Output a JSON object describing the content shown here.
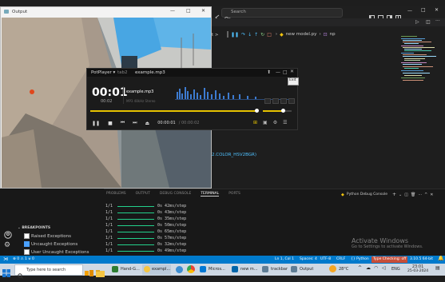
{
  "vscode": {
    "search_placeholder": "Search",
    "breadcrumb_prefix": "t > ",
    "breadcrumb_file": "new model.py",
    "breadcrumb_symbol": "np",
    "code_line": "2.COLOR_HSV2BGR)"
  },
  "output_window": {
    "title": "Output"
  },
  "potplayer": {
    "app_name": "PotPlayer",
    "tab": "tab2",
    "file_title": "example.mp3",
    "time_main": "00:01",
    "time_sub": "00:02",
    "track_name": "example.mp3",
    "info": "MP3   48kHz   Stereo",
    "tooltip": "Exit",
    "current_time": "00:00:01",
    "total_time": "00:00:02"
  },
  "panel": {
    "tabs": [
      "PROBLEMS",
      "OUTPUT",
      "DEBUG CONSOLE",
      "TERMINAL",
      "PORTS"
    ],
    "active_tab": "TERMINAL",
    "debug_console_label": "Python Debug Console",
    "terminal_lines": [
      {
        "step": "1/1",
        "ms": "0s 42ms/step"
      },
      {
        "step": "1/1",
        "ms": "0s 43ms/step"
      },
      {
        "step": "1/1",
        "ms": "0s 35ms/step"
      },
      {
        "step": "1/1",
        "ms": "0s 50ms/step"
      },
      {
        "step": "1/1",
        "ms": "0s 65ms/step"
      },
      {
        "step": "1/1",
        "ms": "0s 57ms/step"
      },
      {
        "step": "1/1",
        "ms": "0s 32ms/step"
      },
      {
        "step": "1/1",
        "ms": "0s 49ms/step"
      }
    ]
  },
  "sidebar": {
    "breakpoints_title": "BREAKPOINTS",
    "items": [
      {
        "label": "Raised Exceptions",
        "checked": false
      },
      {
        "label": "Uncaught Exceptions",
        "checked": true
      },
      {
        "label": "User Uncaught Exceptions",
        "checked": false
      }
    ]
  },
  "watermark": {
    "title": "Activate Windows",
    "subtitle": "Go to Settings to activate Windows."
  },
  "statusbar": {
    "left": "⊗ 0 ⚠ 1   ⊌ 0",
    "position": "Ln 1, Col 1",
    "spaces": "Spaces: 4",
    "encoding": "UTF-8",
    "eol": "CRLF",
    "language": "Python",
    "type_checking": "Type Checking: off",
    "python_version": "3.10.5 64-bit"
  },
  "taskbar": {
    "search_placeholder": "Type here to search",
    "apps": [
      "Hand-G...",
      "exampl...",
      "Micros...",
      "new m...",
      "trackbar",
      "Output"
    ],
    "temperature": "28°C",
    "language": "ENG",
    "time": "23:01",
    "date": "25-03-2024"
  }
}
